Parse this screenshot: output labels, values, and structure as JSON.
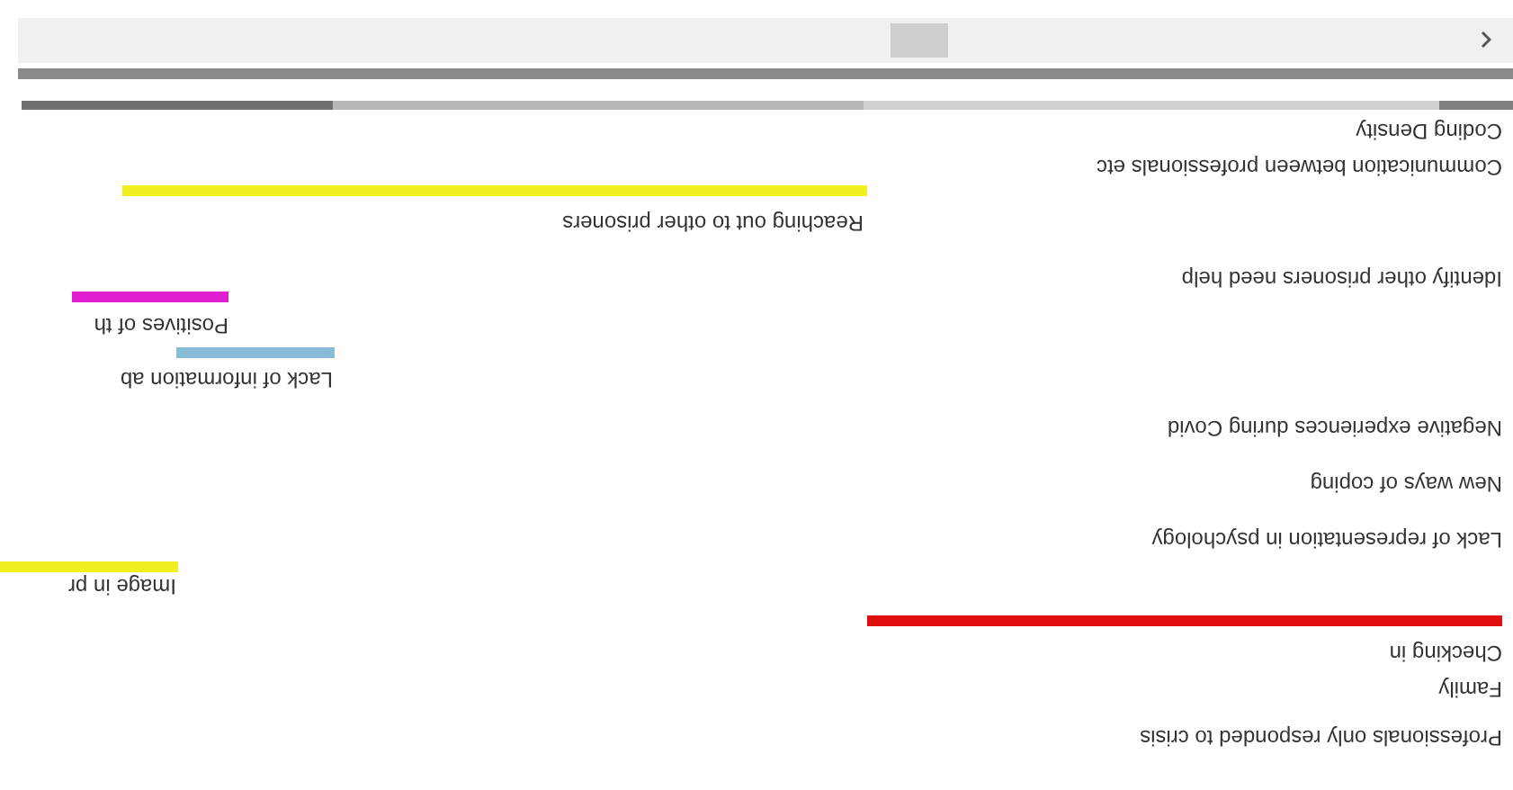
{
  "coding_density": {
    "label": "Coding Density"
  },
  "stripes": [
    {
      "kind": "text",
      "label": "Communication between professionals etc"
    },
    {
      "kind": "bar",
      "label": "Reaching out to other prisoners",
      "color": "#f0f020"
    },
    {
      "kind": "text",
      "label": "Identify other prisoners need help"
    },
    {
      "kind": "bar",
      "label": "Positives of th",
      "color": "#e020d0"
    },
    {
      "kind": "bar",
      "label": "Lack of information ab",
      "color": "#88bcd8"
    },
    {
      "kind": "text",
      "label": "Negative experiences during Covid"
    },
    {
      "kind": "text",
      "label": "New ways of coping"
    },
    {
      "kind": "text",
      "label": "Lack of representation in psychology"
    },
    {
      "kind": "bar",
      "label": "Image in pr",
      "color": "#f0f020"
    },
    {
      "kind": "bar",
      "label": "Checking in",
      "color": "#e01010"
    },
    {
      "kind": "text",
      "label": "Family"
    },
    {
      "kind": "text",
      "label": "Professionals only responded to crisis"
    }
  ]
}
